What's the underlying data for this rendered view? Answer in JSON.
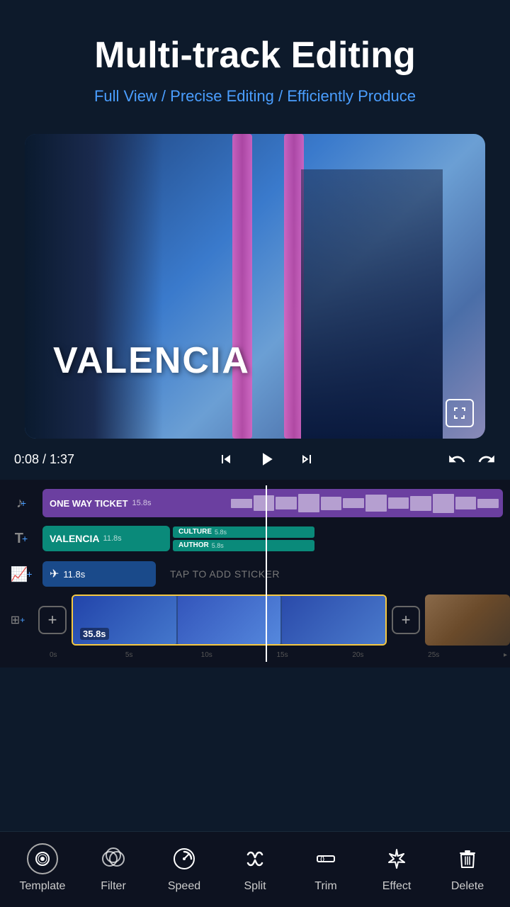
{
  "header": {
    "main_title": "Multi-track Editing",
    "subtitle": "Full View / Precise Editing / Efficiently Produce"
  },
  "player": {
    "time_current": "0:08",
    "time_total": "1:37",
    "time_display": "0:08 / 1:37"
  },
  "video_preview": {
    "text_overlay": "VALENCIA",
    "fullscreen_label": "⛶"
  },
  "tracks": {
    "music": {
      "label": "ONE WAY TICKET",
      "duration": "15.8s"
    },
    "text": {
      "main_label": "VALENCIA",
      "main_duration": "11.8s",
      "secondary_1_label": "CULTURE",
      "secondary_1_duration": "5.8s",
      "secondary_2_label": "AUTHOR",
      "secondary_2_duration": "5.8s"
    },
    "sticker": {
      "duration": "11.8s",
      "add_label": "TAP TO ADD STICKER"
    },
    "video": {
      "main_duration": "35.8s",
      "timeline_marks": [
        "0s",
        "5s",
        "10s",
        "15s",
        "20s",
        "25s"
      ]
    }
  },
  "toolbar": {
    "items": [
      {
        "id": "template",
        "label": "Template",
        "icon": "◎"
      },
      {
        "id": "filter",
        "label": "Filter",
        "icon": "⬤"
      },
      {
        "id": "speed",
        "label": "Speed",
        "icon": "◷"
      },
      {
        "id": "split",
        "label": "Split",
        "icon": "✂"
      },
      {
        "id": "trim",
        "label": "Trim",
        "icon": "⟨⟩"
      },
      {
        "id": "effect",
        "label": "Effect",
        "icon": "✦"
      },
      {
        "id": "delete",
        "label": "Delete",
        "icon": "🗑"
      }
    ]
  }
}
